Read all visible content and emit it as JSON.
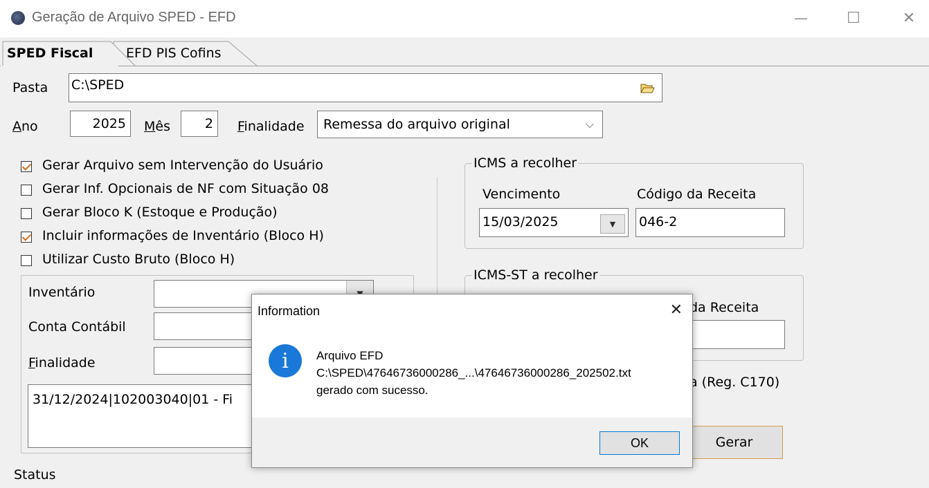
{
  "window": {
    "title": "Geração de Arquivo SPED - EFD",
    "minimize": "—",
    "maximize": "☐",
    "close": "✕"
  },
  "tabs": [
    {
      "label": "SPED Fiscal",
      "active": true
    },
    {
      "label": "EFD PIS Cofins",
      "active": false
    }
  ],
  "form": {
    "pasta_label": "Pasta",
    "pasta_value": "C:\\SPED",
    "ano_label": "Ano",
    "ano_value": "2025",
    "mes_label": "Mês",
    "mes_value": "2",
    "finalidade_label": "Finalidade",
    "finalidade_value": "Remessa do arquivo original"
  },
  "checkboxes": [
    {
      "label": "Gerar Arquivo sem Intervenção do Usuário",
      "checked": true
    },
    {
      "label": "Gerar Inf. Opcionais de NF com Situação 08",
      "checked": false
    },
    {
      "label": "Gerar Bloco K (Estoque e Produção)",
      "checked": false
    },
    {
      "label": "Incluir informações de Inventário (Bloco H)",
      "checked": true
    },
    {
      "label": "Utilizar Custo Bruto (Bloco H)",
      "checked": false
    }
  ],
  "inventory": {
    "inventario_label": "Inventário",
    "conta_label": "Conta Contábil",
    "finalidade_label": "Finalidade",
    "list_item": "31/12/2024|102003040|01 - Fi"
  },
  "icms": {
    "title": "ICMS a recolher",
    "vencimento_label": "Vencimento",
    "codigo_label": "Código da Receita",
    "vencimento_value": "15/03/2025",
    "codigo_value": "046-2"
  },
  "icms_st": {
    "title": "ICMS-ST a recolher",
    "codigo_label_partial": "da Receita"
  },
  "reg_partial": "a (Reg. C170)",
  "gerar_label": "Gerar",
  "status_label": "Status",
  "dialog": {
    "title": "Information",
    "close": "✕",
    "icon": "i",
    "line1": "Arquivo EFD",
    "line2": "C:\\SPED\\47646736000286_...\\47646736000286_202502.txt",
    "line3": "gerado com sucesso.",
    "ok_label": "OK"
  },
  "colors": {
    "check_mark": "#d86a1d",
    "info_icon": "#1a78d8",
    "ok_focus": "#0078d7"
  }
}
